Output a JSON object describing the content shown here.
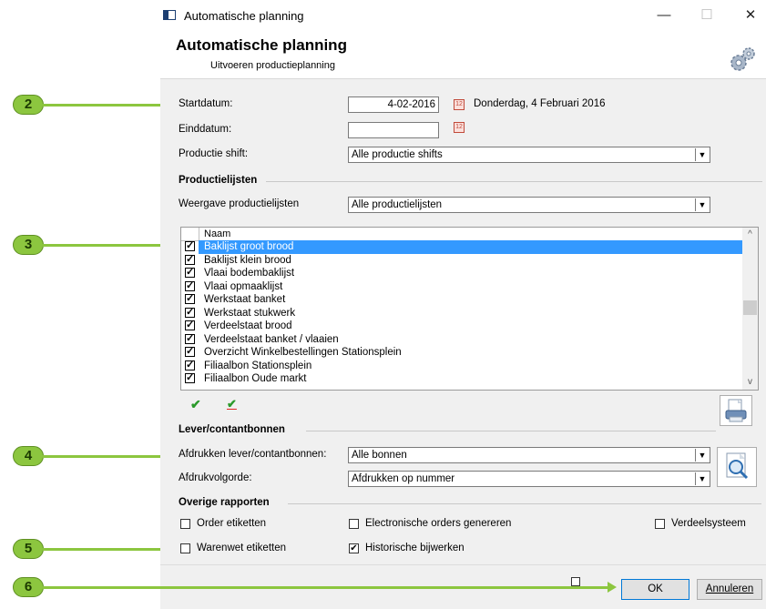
{
  "window": {
    "title": "Automatische planning",
    "minimize": "—",
    "maximize": "☐",
    "close": "✕"
  },
  "header": {
    "title": "Automatische planning",
    "subtitle": "Uitvoeren productieplanning",
    "icon": "gears-icon"
  },
  "form": {
    "startdatum_label": "Startdatum:",
    "startdatum_value": "4-02-2016",
    "startdatum_text": "Donderdag, 4 Februari 2016",
    "einddatum_label": "Einddatum:",
    "einddatum_value": "",
    "shift_label": "Productie shift:",
    "shift_value": "Alle productie shifts",
    "calendar_glyph": "12"
  },
  "productielijsten": {
    "section": "Productielijsten",
    "weergave_label": "Weergave productielijsten",
    "weergave_value": "Alle productielijsten",
    "column_header": "Naam",
    "items": [
      {
        "label": "Baklijst groot brood",
        "checked": true,
        "selected": true
      },
      {
        "label": "Baklijst klein brood",
        "checked": true
      },
      {
        "label": "Vlaai bodembaklijst",
        "checked": true
      },
      {
        "label": "Vlaai opmaaklijst",
        "checked": true
      },
      {
        "label": "Werkstaat banket",
        "checked": true
      },
      {
        "label": "Werkstaat stukwerk",
        "checked": true
      },
      {
        "label": "Verdeelstaat brood",
        "checked": true
      },
      {
        "label": "Verdeelstaat banket / vlaaien",
        "checked": true
      },
      {
        "label": "Overzicht Winkelbestellingen Stationsplein",
        "checked": true
      },
      {
        "label": "Filiaalbon Stationsplein",
        "checked": true
      },
      {
        "label": "Filiaalbon Oude markt",
        "checked": true
      }
    ],
    "check_all_glyph": "✔",
    "uncheck_all_glyph": "✔"
  },
  "lever": {
    "section": "Lever/contantbonnen",
    "afdrukken_label": "Afdrukken lever/contantbonnen:",
    "afdrukken_value": "Alle bonnen",
    "volgorde_label": "Afdrukvolgorde:",
    "volgorde_value": "Afdrukken op nummer"
  },
  "overige": {
    "section": "Overige rapporten",
    "order_etiketten": "Order etiketten",
    "order_etiketten_checked": false,
    "electronische": "Electronische orders genereren",
    "electronische_checked": false,
    "verdeelsysteem": "Verdeelsysteem",
    "verdeelsysteem_checked": false,
    "warenwet": "Warenwet etiketten",
    "warenwet_checked": false,
    "historische": "Historische bijwerken",
    "historische_checked": true
  },
  "buttons": {
    "ok": "OK",
    "annuleren": "Annuleren"
  },
  "callouts": [
    "2",
    "3",
    "4",
    "5",
    "6"
  ],
  "colors": {
    "callout": "#8cc63f",
    "selection": "#3399ff"
  }
}
